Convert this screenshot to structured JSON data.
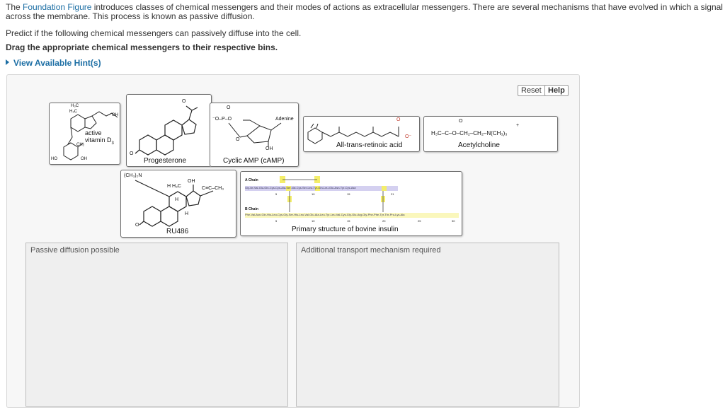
{
  "intro": {
    "before_link": "The ",
    "link_text": "Foundation Figure",
    "after_link": " introduces classes of chemical messengers and their modes of actions as extracellular messengers. There are several mechanisms that have evolved in which a signal can be transmitted across the cell m",
    "line2": "across the membrane. This process is known as passive diffusion."
  },
  "predict_text": "Predict if the following chemical messengers can passively diffuse into the cell.",
  "instruction_text": "Drag the appropriate chemical messengers to their respective bins.",
  "hint_link": "View Available Hint(s)",
  "buttons": {
    "reset": "Reset",
    "help": "Help"
  },
  "tiles": {
    "vitamin_d": {
      "label_line1": "active",
      "label_line2": "vitamin D",
      "subscript": "3",
      "atoms": {
        "h3c1": "H₃C",
        "h3c2": "H₃C",
        "oh_top": "OH",
        "ch2": "CH₂",
        "ho": "HO",
        "oh_bottom": "OH"
      }
    },
    "progesterone": {
      "label": "Progesterone",
      "atoms": {
        "o_carbonyl": "O",
        "o_ring": "O"
      }
    },
    "camp": {
      "label": "Cyclic AMP (cAMP)",
      "atoms": {
        "o_top": "O",
        "p": "⁻O–P–O",
        "adenine": "Adenine",
        "o_bottom": "O",
        "oh": "OH"
      }
    },
    "retinoic": {
      "label": "All-trans-retinoic acid",
      "atoms": {
        "o": "O",
        "o_minus": "O⁻"
      }
    },
    "acetylcholine": {
      "label": "Acetylcholine",
      "formula": "H₃C–C–O–CH₂–CH₂–N(CH₃)₃",
      "atoms": {
        "o": "O",
        "plus": "+"
      }
    },
    "ru486": {
      "label": "RU486",
      "atoms": {
        "nme2": "(CH₃)₂N",
        "oh": "OH",
        "h3c": "H H₃C",
        "alkyne": "C≡C–CH₃",
        "h1": "H",
        "h2": "H",
        "o": "O"
      }
    },
    "insulin": {
      "label": "Primary structure of bovine insulin",
      "a_chain": "A Chain",
      "b_chain": "B Chain",
      "a_sequence": "Gly-Ile-Val-Glu-Gln-Cys-Cys-Ala-Ser-Val-Cys-Ser-Leu-Tyr-Gln-Leu-Glu-Asn-Tyr-Cys-Asn",
      "b_sequence": "Phe-Val-Asn-Gln-His-Leu-Cys-Gly-Ser-His-Leu-Val-Glu-Ala-Leu-Tyr-Leu-Val-Cys-Gly-Glu-Arg-Gly-Phe-Phe-Tyr-Thr-Pro-Lys-Ala",
      "a_numbers": [
        "5",
        "10",
        "15",
        "21"
      ],
      "b_numbers": [
        "5",
        "10",
        "15",
        "20",
        "25",
        "30"
      ],
      "s": "S"
    }
  },
  "bins": {
    "passive": "Passive diffusion possible",
    "additional": "Additional transport mechanism required"
  },
  "colors": {
    "link": "#1c6ea4",
    "highlight": "#f4ee6a",
    "chain_bg": "#d4d0f0"
  }
}
